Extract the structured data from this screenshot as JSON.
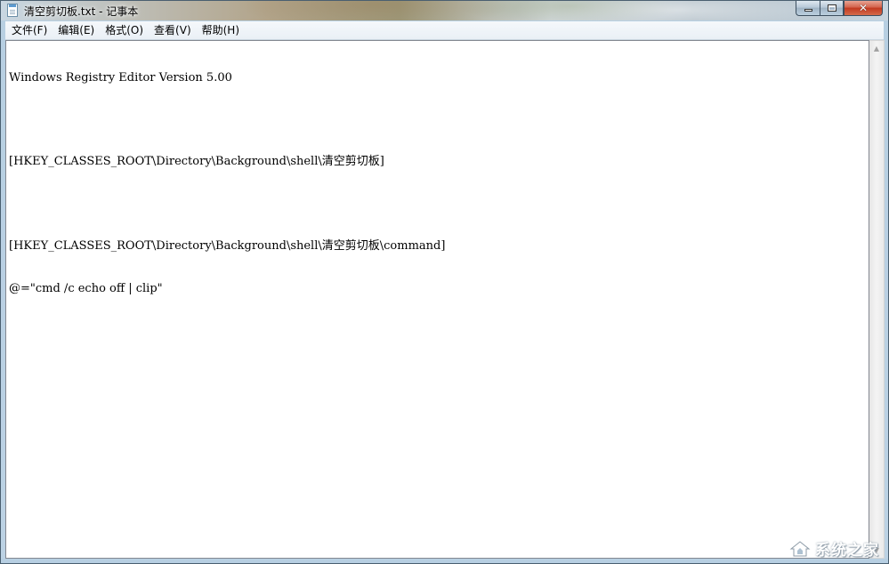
{
  "window": {
    "title": "清空剪切板.txt - 记事本"
  },
  "menubar": {
    "items": [
      "文件(F)",
      "编辑(E)",
      "格式(O)",
      "查看(V)",
      "帮助(H)"
    ]
  },
  "editor": {
    "lines": [
      "Windows Registry Editor Version 5.00",
      "",
      "[HKEY_CLASSES_ROOT\\Directory\\Background\\shell\\清空剪切板]",
      "",
      "[HKEY_CLASSES_ROOT\\Directory\\Background\\shell\\清空剪切板\\command]",
      "@=\"cmd /c echo off | clip\""
    ]
  },
  "icons": {
    "app": "notepad-icon",
    "minimize": "minimize-icon",
    "maximize": "maximize-icon",
    "close": "close-icon",
    "scroll_up": "chevron-up-icon",
    "scroll_down": "chevron-down-icon"
  },
  "watermark": {
    "text": "系统之家"
  },
  "colors": {
    "close_button": "#c2391f",
    "frame": "#b7cfe2",
    "menubar": "#eaf0f6"
  }
}
